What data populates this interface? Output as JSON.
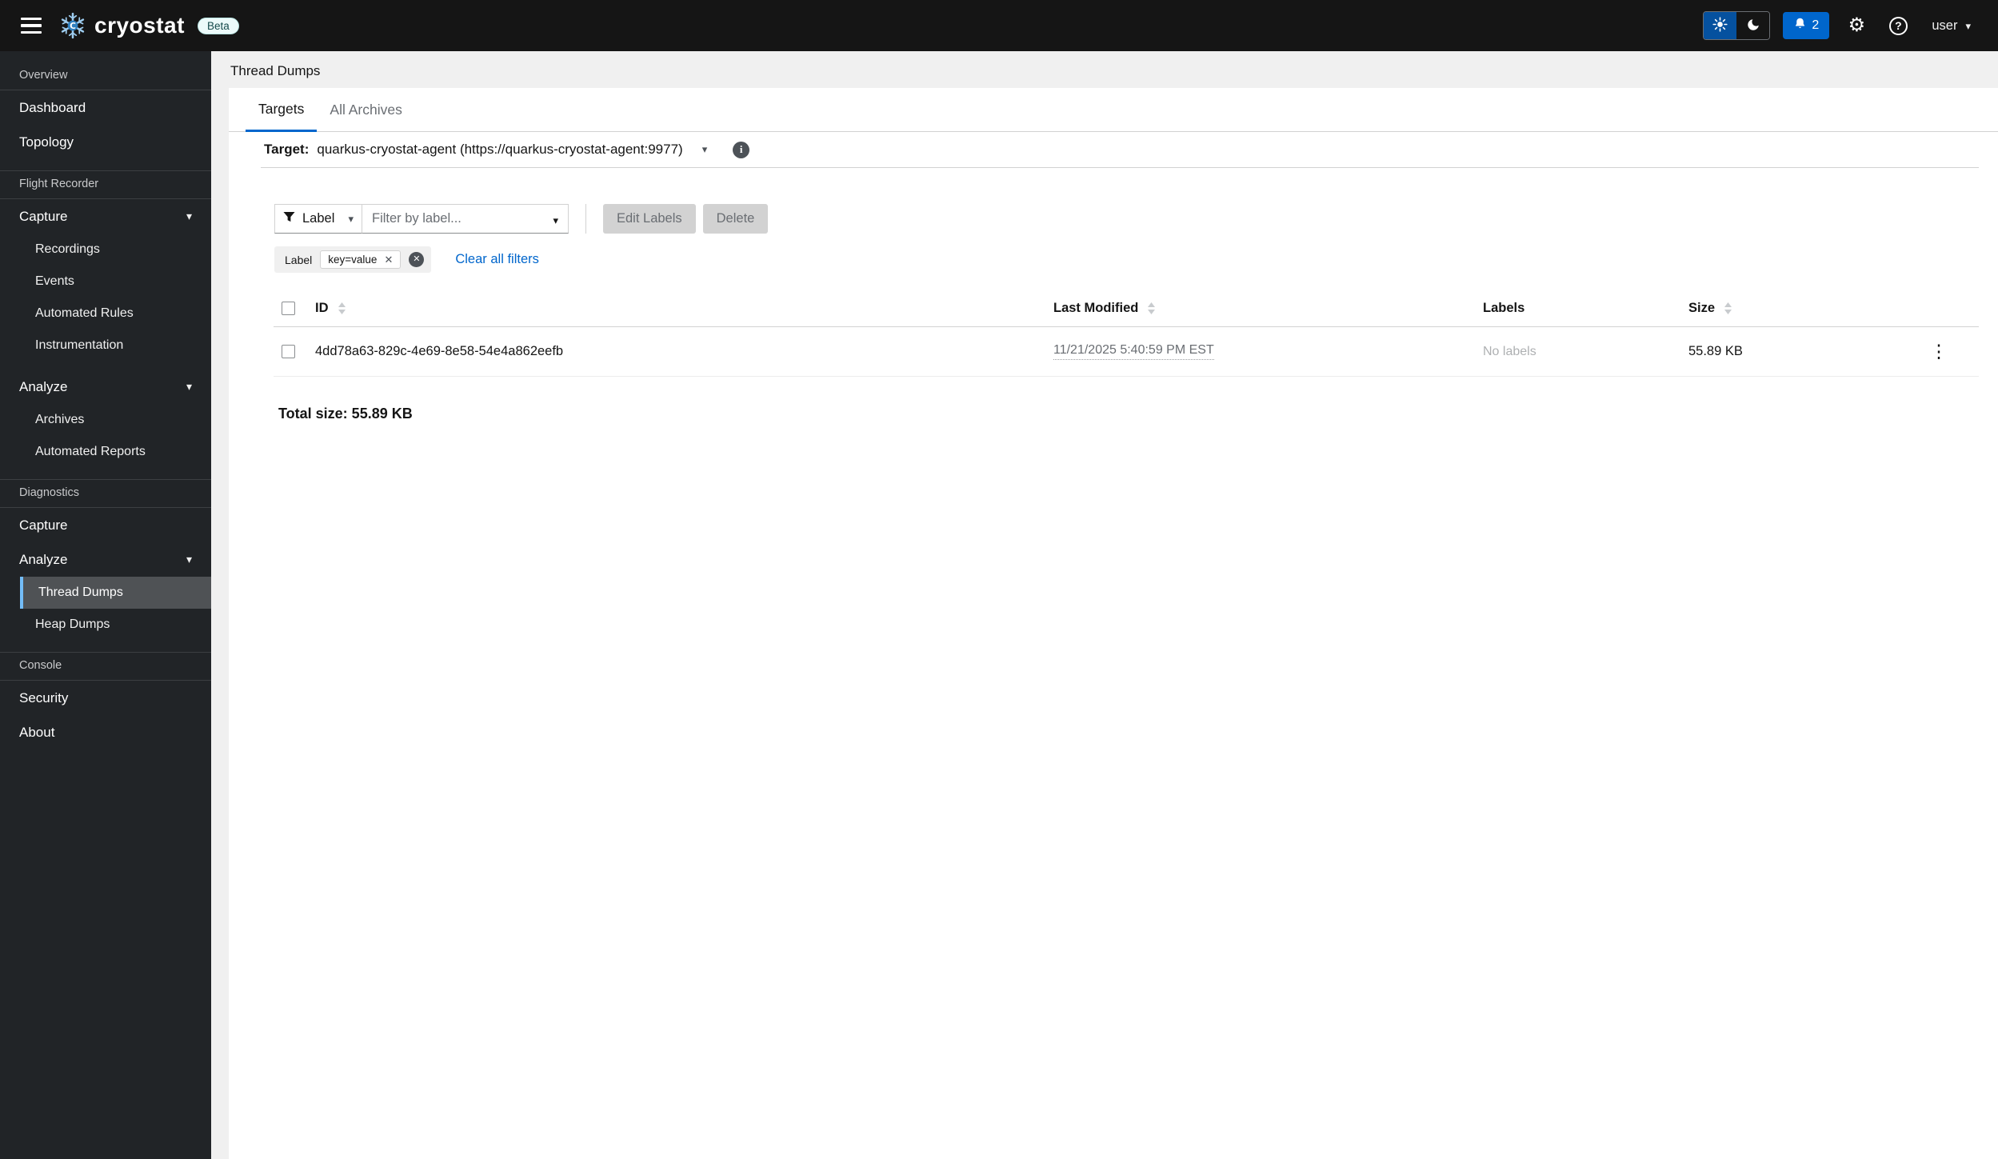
{
  "masthead": {
    "brand": "cryostat",
    "beta_badge": "Beta",
    "notification_count": "2",
    "username": "user"
  },
  "breadcrumb": "Thread Dumps",
  "tabs": {
    "targets": "Targets",
    "all_archives": "All Archives"
  },
  "target_bar": {
    "label": "Target:",
    "value": "quarkus-cryostat-agent (https://quarkus-cryostat-agent:9977)"
  },
  "toolbar": {
    "filter_category": "Label",
    "filter_placeholder": "Filter by label...",
    "edit_labels_label": "Edit Labels",
    "delete_label": "Delete"
  },
  "filters": {
    "chip_group_label": "Label",
    "chips": [
      "key=value"
    ],
    "clear_all_label": "Clear all filters"
  },
  "table": {
    "headers": {
      "id": "ID",
      "last_modified": "Last Modified",
      "labels": "Labels",
      "size": "Size"
    },
    "rows": [
      {
        "id": "4dd78a63-829c-4e69-8e58-54e4a862eefb",
        "last_modified": "11/21/2025 5:40:59 PM EST",
        "labels": "No labels",
        "size": "55.89 KB"
      }
    ],
    "total": "Total size: 55.89 KB"
  },
  "sidebar": {
    "sections": [
      {
        "title": "Overview",
        "items": [
          {
            "label": "Dashboard"
          },
          {
            "label": "Topology"
          }
        ]
      },
      {
        "title": "Flight Recorder",
        "items": [
          {
            "label": "Capture",
            "expandable": true,
            "children": [
              "Recordings",
              "Events",
              "Automated Rules",
              "Instrumentation"
            ]
          },
          {
            "label": "Analyze",
            "expandable": true,
            "children": [
              "Archives",
              "Automated Reports"
            ]
          }
        ]
      },
      {
        "title": "Diagnostics",
        "items": [
          {
            "label": "Capture"
          },
          {
            "label": "Analyze",
            "expandable": true,
            "children": [
              "Thread Dumps",
              "Heap Dumps"
            ],
            "selected_child": "Thread Dumps"
          }
        ]
      },
      {
        "title": "Console",
        "items": [
          {
            "label": "Security"
          },
          {
            "label": "About"
          }
        ]
      }
    ]
  },
  "icons": {
    "nav_toggle": "hamburger-menu",
    "brand_logo": "snowflake-c-logo",
    "theme_light": "sun",
    "theme_dark": "moon",
    "notifications": "bell",
    "settings": "gear",
    "help": "question-circle",
    "user_caret": "caret-down",
    "target_info": "info-circle",
    "filter": "funnel",
    "chip_remove": "times",
    "chip_group_remove": "times-circle",
    "column_sort": "sort-arrows",
    "row_actions": "kebab-vertical"
  },
  "colors": {
    "accent": "#0066cc",
    "masthead_bg": "#151515",
    "sidebar_bg": "#212427",
    "nav_selected_bg": "#4f5255",
    "nav_selected_border": "#73bcf7",
    "content_bg": "#f0f0f0",
    "border": "#d2d2d2",
    "text_secondary": "#6a6e73",
    "disabled_bg": "#d2d2d2",
    "link": "#0066cc"
  }
}
